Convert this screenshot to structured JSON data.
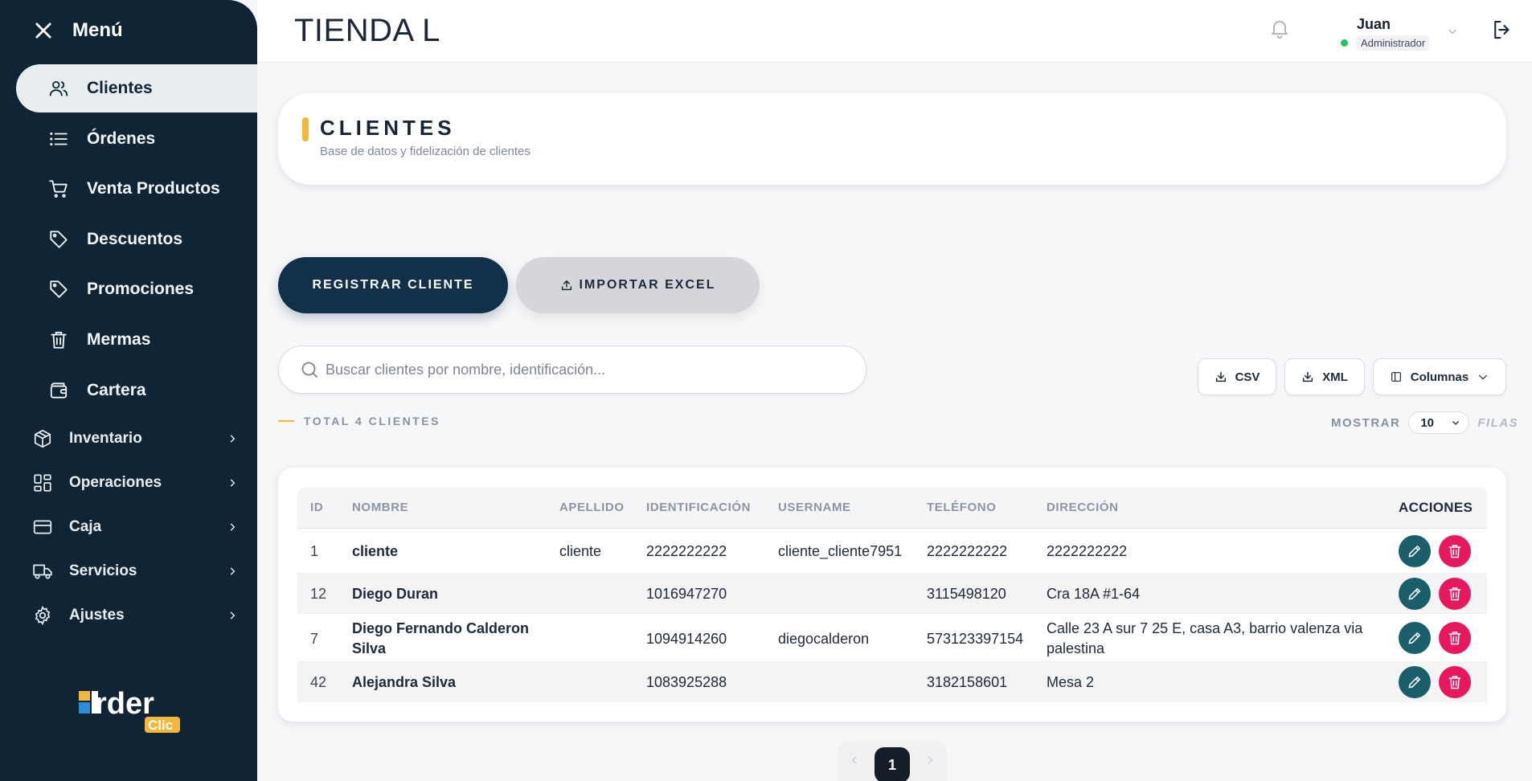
{
  "sidebar": {
    "menu_title": "Menú",
    "items": [
      {
        "label": "Clientes",
        "icon": "users-icon"
      },
      {
        "label": "Órdenes",
        "icon": "list-icon"
      },
      {
        "label": "Venta Productos",
        "icon": "cart-icon"
      },
      {
        "label": "Descuentos",
        "icon": "tag-icon"
      },
      {
        "label": "Promociones",
        "icon": "tag-icon"
      },
      {
        "label": "Mermas",
        "icon": "trash-icon"
      },
      {
        "label": "Cartera",
        "icon": "wallet-icon"
      }
    ],
    "groups": [
      {
        "label": "Inventario",
        "icon": "box-icon"
      },
      {
        "label": "Operaciones",
        "icon": "grid-icon"
      },
      {
        "label": "Caja",
        "icon": "card-icon"
      },
      {
        "label": "Servicios",
        "icon": "truck-icon"
      },
      {
        "label": "Ajustes",
        "icon": "gear-icon"
      }
    ],
    "logo_text": "Order Clic"
  },
  "header": {
    "store_name": "TIENDA L",
    "user_name": "Juan",
    "user_role": "Administrador"
  },
  "page": {
    "title": "CLIENTES",
    "subtitle": "Base de datos y fidelización de clientes",
    "register_label": "REGISTRAR CLIENTE",
    "import_label": "IMPORTAR EXCEL",
    "search_placeholder": "Buscar clientes por nombre, identificación...",
    "csv_label": "CSV",
    "xml_label": "XML",
    "columns_label": "Columnas",
    "total_label": "TOTAL 4 CLIENTES",
    "show_label": "MOSTRAR",
    "rows_per_page": "10",
    "rows_label": "FILAS"
  },
  "table": {
    "columns": [
      "ID",
      "NOMBRE",
      "APELLIDO",
      "IDENTIFICACIÓN",
      "USERNAME",
      "TELÉFONO",
      "DIRECCIÓN",
      "ACCIONES"
    ],
    "rows": [
      {
        "id": "1",
        "nombre": "cliente",
        "apellido": "cliente",
        "identificacion": "2222222222",
        "username": "cliente_cliente7951",
        "telefono": "2222222222",
        "direccion": "2222222222"
      },
      {
        "id": "12",
        "nombre": "Diego Duran",
        "apellido": "",
        "identificacion": "1016947270",
        "username": "",
        "telefono": "3115498120",
        "direccion": "Cra 18A #1-64"
      },
      {
        "id": "7",
        "nombre": "Diego Fernando Calderon Silva",
        "apellido": "",
        "identificacion": "1094914260",
        "username": "diegocalderon",
        "telefono": "573123397154",
        "direccion": "Calle 23 A sur 7 25 E, casa A3, barrio valenza via palestina"
      },
      {
        "id": "42",
        "nombre": "Alejandra Silva",
        "apellido": "",
        "identificacion": "1083925288",
        "username": "",
        "telefono": "3182158601",
        "direccion": "Mesa 2"
      }
    ]
  },
  "pagination": {
    "current_page": "1"
  },
  "colors": {
    "sidebar": "#0f2536",
    "accent": "#f4b73c",
    "edit": "#1b5e6b",
    "delete": "#e8185c",
    "primary_button": "#12304a"
  }
}
